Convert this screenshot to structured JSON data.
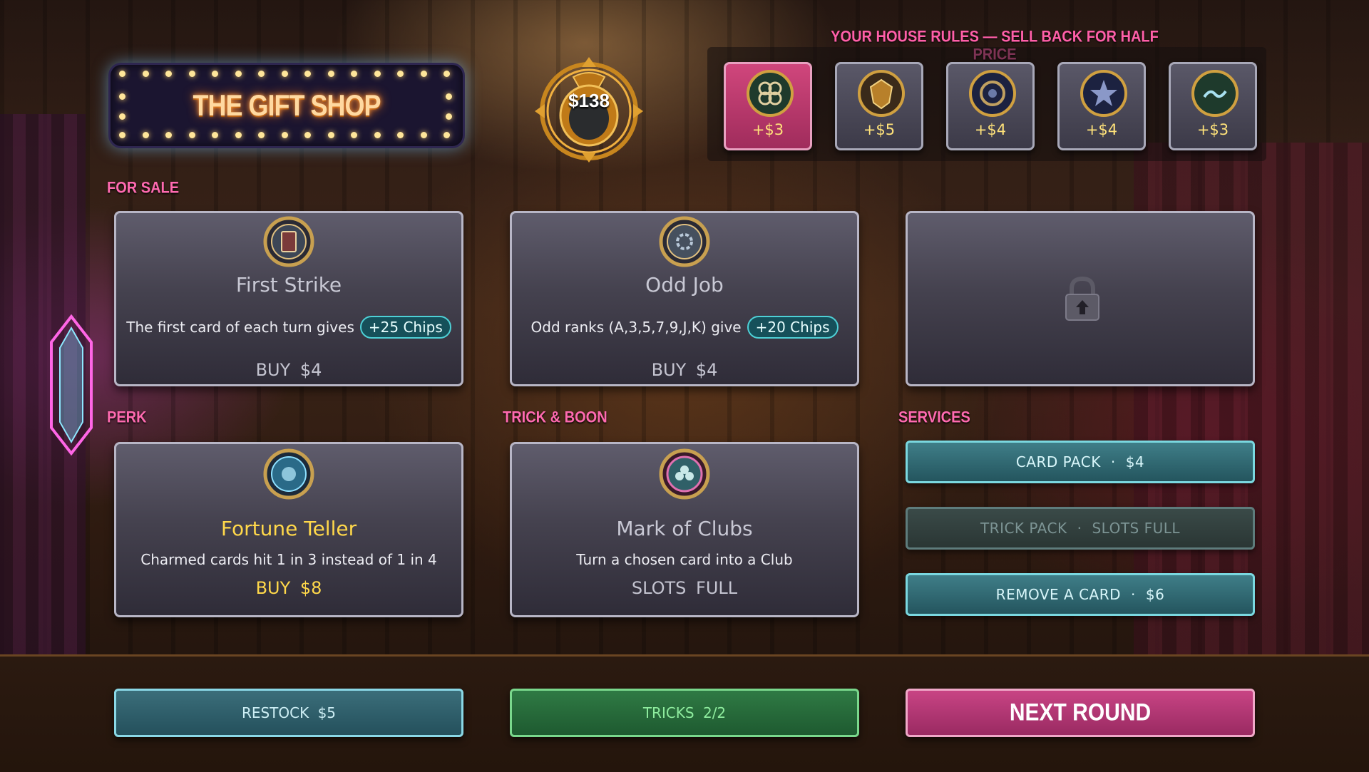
{
  "shop": {
    "title": "THE GIFT SHOP"
  },
  "money": {
    "amount": "$138"
  },
  "house_rules": {
    "label": "YOUR HOUSE RULES — SELL BACK FOR HALF PRICE",
    "items": [
      {
        "price": "+$3",
        "icon": "clover-emblem-icon",
        "active": true
      },
      {
        "price": "+$5",
        "icon": "crest-emblem-icon",
        "active": false
      },
      {
        "price": "+$4",
        "icon": "ring-emblem-icon",
        "active": false
      },
      {
        "price": "+$4",
        "icon": "star-emblem-icon",
        "active": false
      },
      {
        "price": "+$3",
        "icon": "wave-emblem-icon",
        "active": false
      }
    ]
  },
  "sections": {
    "for_sale": "FOR SALE",
    "perk": "PERK",
    "trick_boon": "TRICK & BOON",
    "services": "SERVICES"
  },
  "for_sale": [
    {
      "name": "First Strike",
      "desc": "The first card of each turn gives",
      "badge": "+25 Chips",
      "price": "BUY $4",
      "icon": "card-emblem-icon"
    },
    {
      "name": "Odd Job",
      "desc": "Odd ranks (A,3,5,7,9,J,K) give",
      "badge": "+20 Chips",
      "price": "BUY $4",
      "icon": "gear-emblem-icon"
    },
    {
      "locked": true,
      "icon": "lock-icon"
    }
  ],
  "perk": {
    "name": "Fortune Teller",
    "desc": "Charmed cards hit 1 in 3 instead of 1 in 4",
    "price": "BUY $8",
    "icon": "crystal-emblem-icon"
  },
  "trick": {
    "name": "Mark of Clubs",
    "desc": "Turn a chosen card into a Club",
    "status": "SLOTS FULL",
    "icon": "club-emblem-icon"
  },
  "services": [
    {
      "label": "CARD PACK",
      "value": "$4",
      "enabled": true
    },
    {
      "label": "TRICK PACK",
      "value": "SLOTS FULL",
      "enabled": false
    },
    {
      "label": "REMOVE A CARD",
      "value": "$6",
      "enabled": true
    }
  ],
  "bottom": {
    "restock": "RESTOCK $5",
    "tricks": "TRICKS 2/2",
    "next_round": "NEXT ROUND"
  },
  "colors": {
    "accent_pink": "#ff6ab0",
    "gold": "#ffd84a",
    "teal": "#4ed0d6",
    "green": "#7ad88c"
  }
}
